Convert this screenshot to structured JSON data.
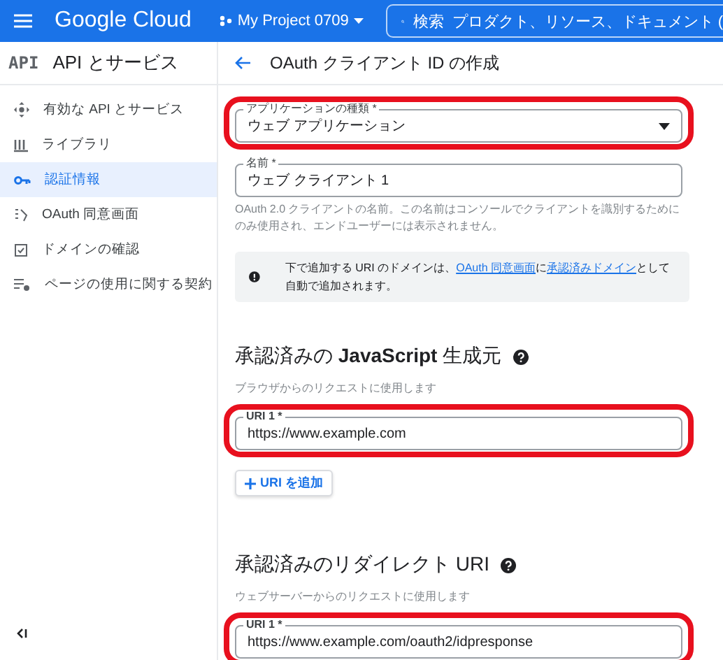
{
  "top_bar": {
    "brand": "Google Cloud",
    "project": "My Project 0709",
    "search": {
      "label": "検索",
      "placeholder": "プロダクト、リソース、ドキュメント ("
    }
  },
  "sidebar": {
    "logo": "API",
    "title": "API とサービス",
    "items": [
      {
        "label": "有効な API とサービス",
        "selected": false
      },
      {
        "label": "ライブラリ",
        "selected": false
      },
      {
        "label": "認証情報",
        "selected": true
      },
      {
        "label": "OAuth 同意画面",
        "selected": false
      },
      {
        "label": "ドメインの確認",
        "selected": false
      },
      {
        "label": "ページの使用に関する契約",
        "selected": false
      }
    ]
  },
  "page": {
    "title": "OAuth クライアント ID の作成",
    "app_type": {
      "label": "アプリケーションの種類 *",
      "value": "ウェブ アプリケーション",
      "highlighted": true
    },
    "name": {
      "label": "名前 *",
      "value": "ウェブ クライアント 1",
      "hint": "OAuth 2.0 クライアントの名前。この名前はコンソールでクライアントを識別するためにのみ使用され、エンドユーザーには表示されません。"
    },
    "info": {
      "before": "下で追加する URI のドメインは、",
      "link1": "OAuth 同意画面",
      "middle": "に",
      "link2": "承認済みドメイン",
      "after": "として自動で追加されます。"
    },
    "sections": [
      {
        "title": "承認済みの **JavaScript** 生成元",
        "subtitle": "ブラウザからのリクエストに使用します",
        "uris": [
          {
            "label": "URI 1 *",
            "value": "https://www.example.com",
            "highlighted": true
          }
        ],
        "add_button": "URI を追加"
      },
      {
        "title": "承認済みのリダイレクト URI",
        "subtitle": "ウェブサーバーからのリクエストに使用します",
        "uris": [
          {
            "label": "URI 1 *",
            "value": "https://www.example.com/oauth2/idpresponse",
            "highlighted": true
          }
        ]
      }
    ]
  }
}
